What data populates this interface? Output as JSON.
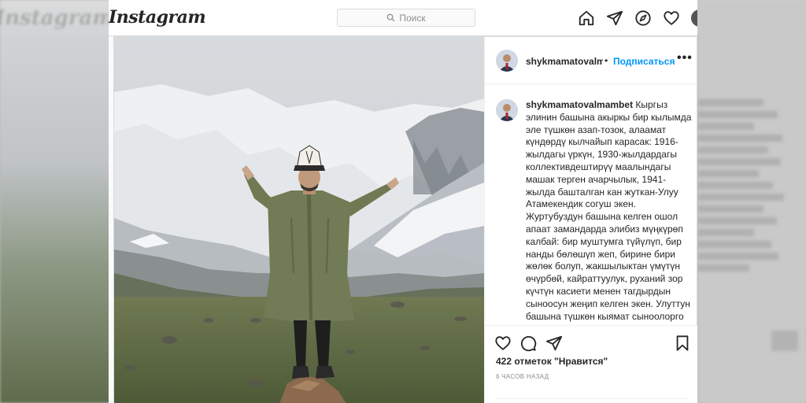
{
  "app": {
    "logo": "Instagram",
    "backdrop_logo": "Instagram"
  },
  "search": {
    "placeholder": "Поиск"
  },
  "nav": {
    "icons": [
      "home-icon",
      "direct-icon",
      "explore-icon",
      "activity-heart-icon",
      "profile-avatar"
    ]
  },
  "post": {
    "username": "shykmamatovalmambet",
    "username_truncated": "shykmamatovalmaı",
    "separator": "•",
    "follow_label": "Подписаться",
    "more_label": "•••",
    "caption_user": "shykmamatovalmambet",
    "caption_text": " Кыргыз элинин башына акыркы бир кылымда эле түшкөн азап-тозок, алаамат күндөрдү кылчайып карасак: 1916-жылдагы үркүн, 1930-жылдардагы коллективдештирүү маалындагы машак терген ачарчылык, 1941-жылда башталган кан жуткан-Улуу Атамекендик согуш экен. Журтубуздун башына келген ошол апаат замандарда элибиз мүңкүрөп калбай: бир муштумга түйүлүп, бир нанды бөлөшүп жеп, бирине бири жөлөк болуп, жакшылыктан үмүтүн өчүрбөй, кайраттуулук, руханий зор күчтүн касиети менен тагдырдын сыноосун жеңип келген экен. Улуттун башына түшкөн кыямат сыноолорго",
    "likes": "422 отметок \"Нравится\"",
    "time": "6 ЧАСОВ НАЗАД"
  },
  "colors": {
    "accent": "#0095f6",
    "text": "#262626",
    "muted": "#8e8e8e",
    "border": "#dbdbdb"
  }
}
